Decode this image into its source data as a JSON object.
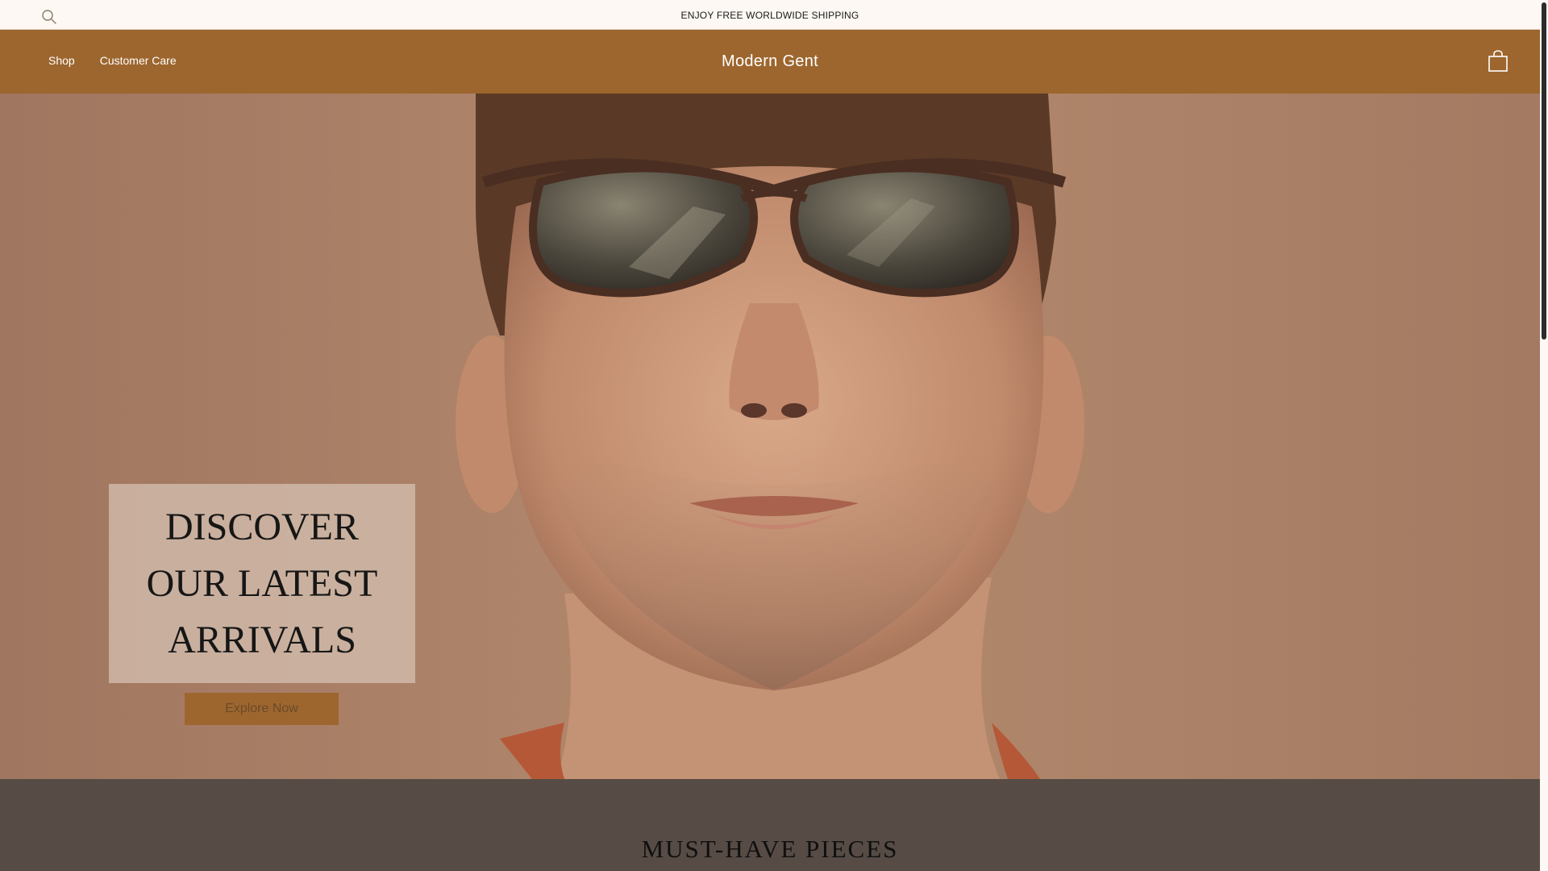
{
  "announcement": {
    "text": "ENJOY FREE WORLDWIDE SHIPPING",
    "search_icon": "search-icon"
  },
  "header": {
    "brand": "Modern Gent",
    "nav": [
      {
        "label": "Shop"
      },
      {
        "label": "Customer Care"
      }
    ],
    "cart_icon": "shopping-bag-icon"
  },
  "hero": {
    "heading": "DISCOVER\nOUR LATEST\nARRIVALS",
    "cta_label": "Explore Now"
  },
  "section": {
    "title": "MUST-HAVE PIECES"
  },
  "colors": {
    "announcement_bg": "#fdf8f3",
    "header_bg": "#9d662e",
    "hero_card_bg": "#d4beae",
    "section_bg": "#564b45"
  }
}
